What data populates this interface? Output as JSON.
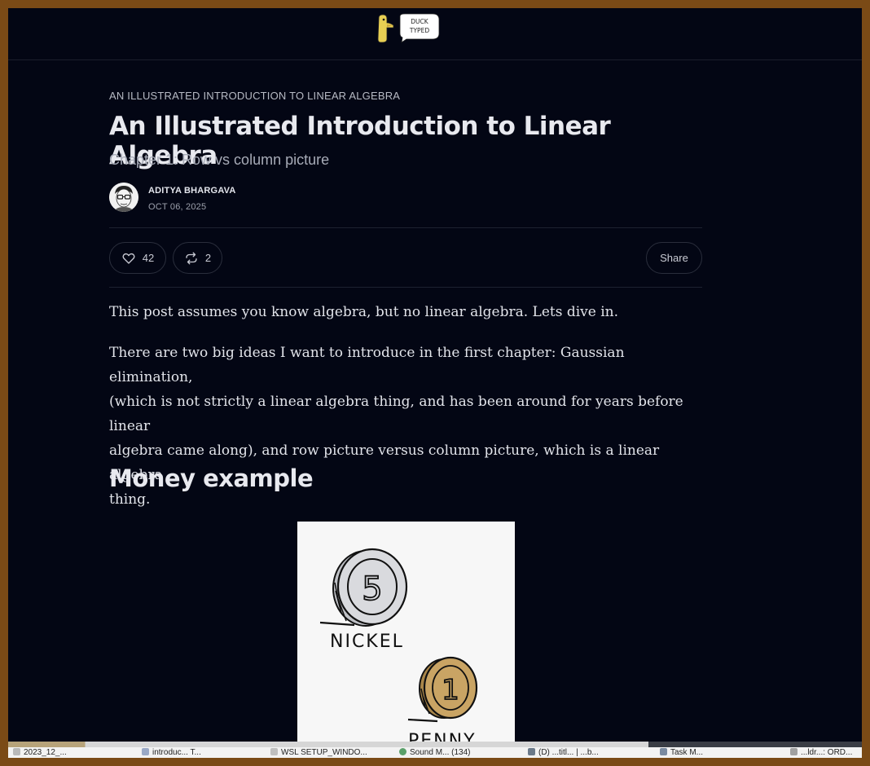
{
  "brand": {
    "logo_text_line1": "DUCK",
    "logo_text_line2": "TYPED",
    "colors": {
      "duck": "#e8cf53",
      "bubble": "#ffffff"
    }
  },
  "article": {
    "kicker": "AN ILLUSTRATED INTRODUCTION TO LINEAR ALGEBRA",
    "title": "An Illustrated Introduction to Linear Algebra",
    "subtitle": "Chapter 1: Row vs column picture",
    "author_name": "ADITYA BHARGAVA",
    "date": "OCT 06, 2025"
  },
  "actions": {
    "like_count": "42",
    "restack_count": "2",
    "share_label": "Share"
  },
  "body": {
    "paragraph1": "This post assumes you know algebra, but no linear algebra. Lets dive in.",
    "paragraph2_line1": "There are two big ideas I want to introduce in the first chapter: Gaussian elimination,",
    "paragraph2_line2": "(which is not strictly a linear algebra thing, and has been around for years before linear",
    "paragraph2_line3": "algebra came along), and row picture versus column picture, which is a linear algebra",
    "paragraph2_line4": "thing.",
    "heading": "Money example"
  },
  "figure": {
    "nickel_label": "NICKEL",
    "nickel_value": "5",
    "penny_label": "PENNY",
    "penny_value": "1",
    "colors": {
      "nickel": "#d9dade",
      "penny": "#c9a464"
    }
  },
  "taskbar": {
    "items": [
      "2023_12_...",
      "introduc... T...",
      "WSL SETUP_WINDO...",
      "Sound M... (134)",
      "(D) ...titl... | ...b...",
      "Task M...",
      "...ldr...: ORD..."
    ]
  },
  "theme": {
    "page_bg": "#030614",
    "frame": "#7a4a16",
    "text": "#e2e4ea",
    "muted": "#a7abb7"
  }
}
